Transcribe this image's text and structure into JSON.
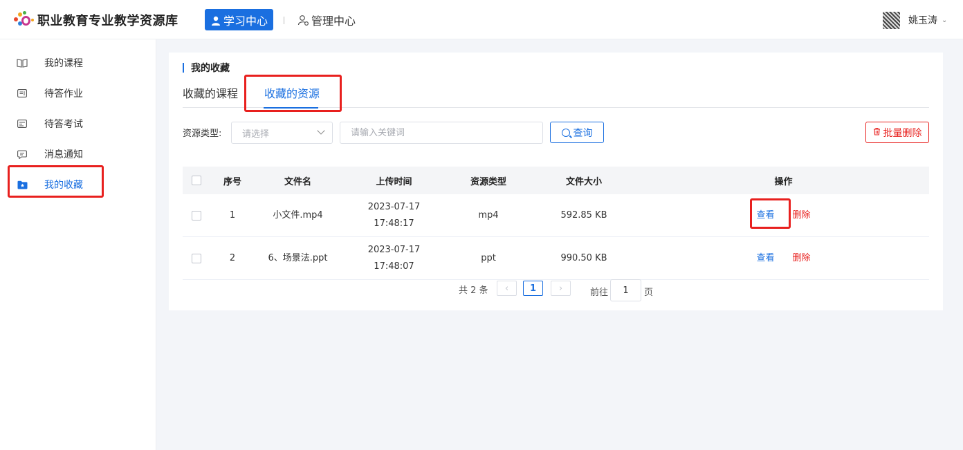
{
  "header": {
    "app_title": "职业教育专业教学资源库",
    "nav_active_label": "学习中心",
    "nav_label": "管理中心",
    "user_name": "姚玉涛"
  },
  "sidebar": {
    "items": [
      {
        "label": "我的课程",
        "icon": "book-open-icon"
      },
      {
        "label": "待答作业",
        "icon": "assignment-icon"
      },
      {
        "label": "待答考试",
        "icon": "exam-icon"
      },
      {
        "label": "消息通知",
        "icon": "message-icon"
      },
      {
        "label": "我的收藏",
        "icon": "favorite-folder-icon",
        "active": true
      }
    ]
  },
  "main": {
    "title": "我的收藏",
    "tabs": [
      {
        "label": "收藏的课程",
        "active": false
      },
      {
        "label": "收藏的资源",
        "active": true
      }
    ],
    "filter": {
      "type_label": "资源类型:",
      "type_placeholder": "请选择",
      "keyword_placeholder": "请输入关键词",
      "search_label": "查询",
      "batch_delete_label": "批量删除"
    },
    "table": {
      "headers": {
        "index": "序号",
        "name": "文件名",
        "time": "上传时间",
        "type": "资源类型",
        "size": "文件大小",
        "op": "操作"
      },
      "rows": [
        {
          "index": "1",
          "name": "小文件.mp4",
          "time": "2023-07-17 17:48:17",
          "type": "mp4",
          "size": "592.85 KB",
          "view": "查看",
          "delete": "删除"
        },
        {
          "index": "2",
          "name": "6、场景法.ppt",
          "time": "2023-07-17 17:48:07",
          "type": "ppt",
          "size": "990.50 KB",
          "view": "查看",
          "delete": "删除"
        }
      ]
    },
    "pagination": {
      "total_text": "共 2 条",
      "current_page": "1",
      "goto_label": "前往",
      "goto_value": "1",
      "unit_label": "页"
    }
  },
  "colors": {
    "accent": "#1a6fe0",
    "danger": "#e8201e",
    "highlight_box": "#e8201e"
  }
}
